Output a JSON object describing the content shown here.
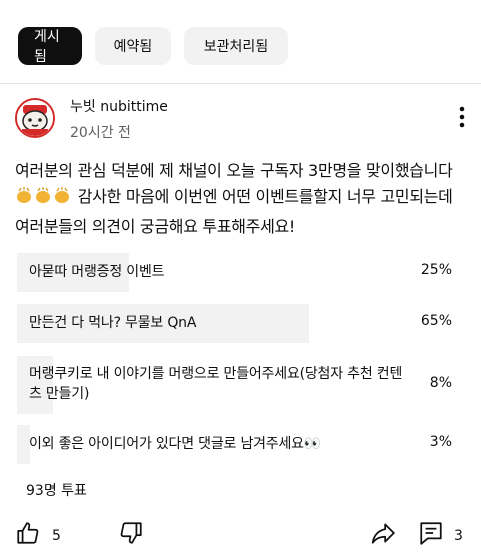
{
  "tabs": [
    {
      "label": "게시됨",
      "active": true
    },
    {
      "label": "예약됨",
      "active": false
    },
    {
      "label": "보관처리됨",
      "active": false
    }
  ],
  "post": {
    "channel_name": "누빗 nubittime",
    "timestamp": "20시간 전",
    "text_before_emoji": "여러분의 관심 덕분에 제 채널이 오늘 구독자 3만명을 맞이했습니다",
    "emoji": "clapping-hands-x3",
    "text_after_emoji": " 감사한 마음에 이번엔 어떤 이벤트를할지 너무 고민되는데 여러분들의 의견이 궁금해요 투표해주세요!"
  },
  "poll": {
    "options": [
      {
        "label": "아묻따 머랭증정 이벤트",
        "percent_label": "25%",
        "percent": 25
      },
      {
        "label": "만든건 다 먹나? 무물보 QnA",
        "percent_label": "65%",
        "percent": 65
      },
      {
        "label": "머랭쿠키로 내 이야기를 머랭으로 만들어주세요(당첨자 추천 컨텐츠 만들기)",
        "percent_label": "8%",
        "percent": 8
      },
      {
        "label": "이외 좋은 아이디어가 있다면 댓글로 남겨주세요👀",
        "percent_label": "3%",
        "percent": 3
      }
    ],
    "vote_count": "93명 투표"
  },
  "actions": {
    "like_count": "5",
    "comment_count": "3"
  },
  "colors": {
    "active_tab": "#0f0f0f",
    "chip": "#f2f2f2",
    "secondary_text": "#606060",
    "avatar_accent": "#d52a2a"
  }
}
